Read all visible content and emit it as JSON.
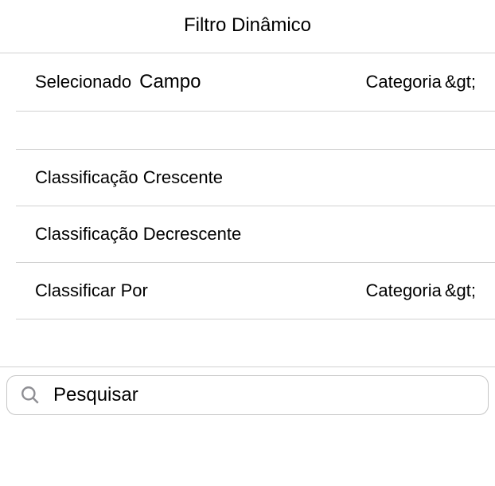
{
  "header": {
    "title": "Filtro Dinâmico"
  },
  "selected_field": {
    "label": "Selecionado",
    "sublabel": "Campo",
    "value": "Categoria",
    "chevron": "&gt;"
  },
  "sort_asc": {
    "label": "Classificação Crescente"
  },
  "sort_desc": {
    "label": "Classificação Decrescente"
  },
  "sort_by": {
    "label": "Classificar Por",
    "value": "Categoria",
    "chevron": "&gt;"
  },
  "search": {
    "placeholder": "Pesquisar"
  }
}
